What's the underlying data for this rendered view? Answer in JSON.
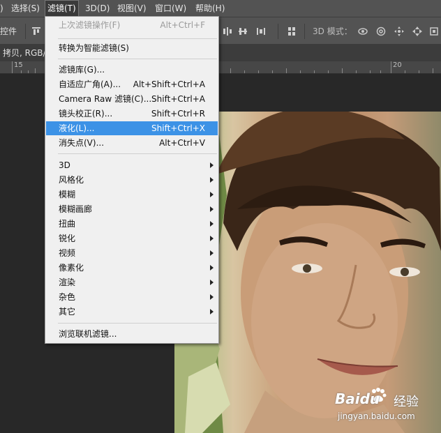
{
  "menubar": {
    "items": [
      {
        "label": ")"
      },
      {
        "label": "选择(S)"
      },
      {
        "label": "滤镜(T)"
      },
      {
        "label": "3D(D)"
      },
      {
        "label": "视图(V)"
      },
      {
        "label": "窗口(W)"
      },
      {
        "label": "帮助(H)"
      }
    ]
  },
  "optionsbar": {
    "left_text": "控件",
    "mode_label": "3D 模式："
  },
  "document": {
    "tab_title": "拷贝, RGB/"
  },
  "ruler": {
    "labels": [
      "15",
      "20"
    ]
  },
  "filter_menu": {
    "items": [
      {
        "label": "上次滤镜操作(F)",
        "shortcut": "Alt+Ctrl+F",
        "disabled": true
      },
      {
        "label": "转换为智能滤镜(S)",
        "shortcut": ""
      },
      {
        "label": "滤镜库(G)...",
        "shortcut": ""
      },
      {
        "label": "自适应广角(A)...",
        "shortcut": "Alt+Shift+Ctrl+A"
      },
      {
        "label": "Camera Raw 滤镜(C)...",
        "shortcut": "Shift+Ctrl+A"
      },
      {
        "label": "镜头校正(R)...",
        "shortcut": "Shift+Ctrl+R"
      },
      {
        "label": "液化(L)...",
        "shortcut": "Shift+Ctrl+X",
        "highlighted": true
      },
      {
        "label": "消失点(V)...",
        "shortcut": "Alt+Ctrl+V"
      },
      {
        "label": "3D",
        "submenu": true
      },
      {
        "label": "风格化",
        "submenu": true
      },
      {
        "label": "模糊",
        "submenu": true
      },
      {
        "label": "模糊画廊",
        "submenu": true
      },
      {
        "label": "扭曲",
        "submenu": true
      },
      {
        "label": "锐化",
        "submenu": true
      },
      {
        "label": "视频",
        "submenu": true
      },
      {
        "label": "像素化",
        "submenu": true
      },
      {
        "label": "渲染",
        "submenu": true
      },
      {
        "label": "杂色",
        "submenu": true
      },
      {
        "label": "其它",
        "submenu": true
      },
      {
        "label": "浏览联机滤镜..."
      }
    ]
  },
  "watermark": {
    "brand": "Baidu",
    "brand_cn": "经验",
    "url": "jingyan.baidu.com"
  },
  "colors": {
    "menu_highlight": "#3c92e6",
    "menubar_bg": "#535353",
    "canvas_bg": "#282828"
  }
}
